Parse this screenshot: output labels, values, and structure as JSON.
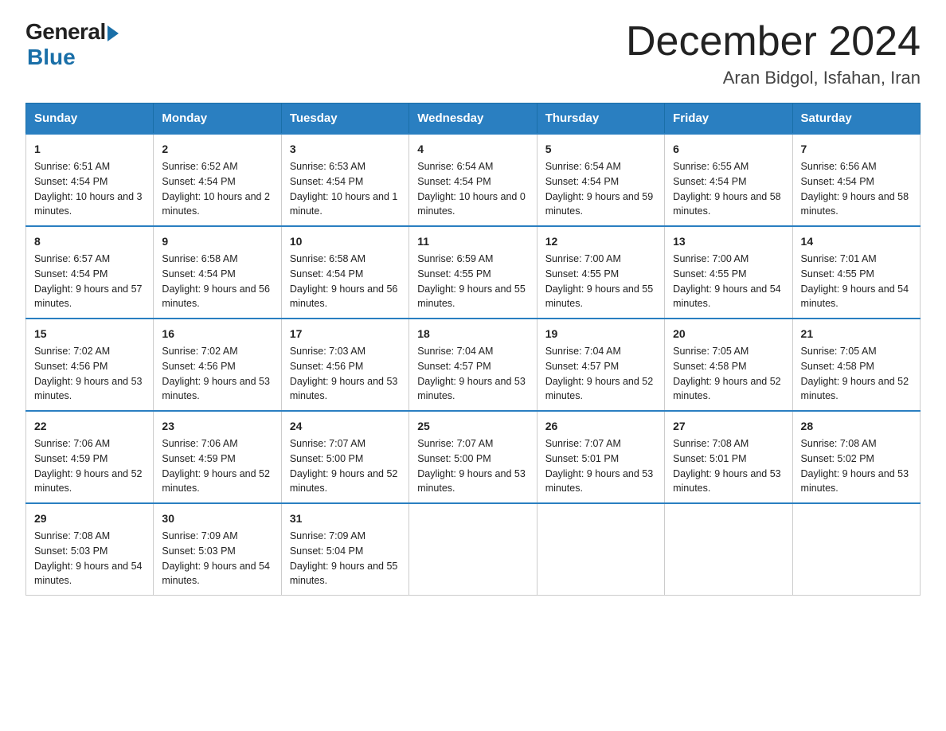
{
  "header": {
    "logo_general": "General",
    "logo_blue": "Blue",
    "month_title": "December 2024",
    "location": "Aran Bidgol, Isfahan, Iran"
  },
  "weekdays": [
    "Sunday",
    "Monday",
    "Tuesday",
    "Wednesday",
    "Thursday",
    "Friday",
    "Saturday"
  ],
  "weeks": [
    [
      {
        "day": "1",
        "sunrise": "6:51 AM",
        "sunset": "4:54 PM",
        "daylight": "10 hours and 3 minutes."
      },
      {
        "day": "2",
        "sunrise": "6:52 AM",
        "sunset": "4:54 PM",
        "daylight": "10 hours and 2 minutes."
      },
      {
        "day": "3",
        "sunrise": "6:53 AM",
        "sunset": "4:54 PM",
        "daylight": "10 hours and 1 minute."
      },
      {
        "day": "4",
        "sunrise": "6:54 AM",
        "sunset": "4:54 PM",
        "daylight": "10 hours and 0 minutes."
      },
      {
        "day": "5",
        "sunrise": "6:54 AM",
        "sunset": "4:54 PM",
        "daylight": "9 hours and 59 minutes."
      },
      {
        "day": "6",
        "sunrise": "6:55 AM",
        "sunset": "4:54 PM",
        "daylight": "9 hours and 58 minutes."
      },
      {
        "day": "7",
        "sunrise": "6:56 AM",
        "sunset": "4:54 PM",
        "daylight": "9 hours and 58 minutes."
      }
    ],
    [
      {
        "day": "8",
        "sunrise": "6:57 AM",
        "sunset": "4:54 PM",
        "daylight": "9 hours and 57 minutes."
      },
      {
        "day": "9",
        "sunrise": "6:58 AM",
        "sunset": "4:54 PM",
        "daylight": "9 hours and 56 minutes."
      },
      {
        "day": "10",
        "sunrise": "6:58 AM",
        "sunset": "4:54 PM",
        "daylight": "9 hours and 56 minutes."
      },
      {
        "day": "11",
        "sunrise": "6:59 AM",
        "sunset": "4:55 PM",
        "daylight": "9 hours and 55 minutes."
      },
      {
        "day": "12",
        "sunrise": "7:00 AM",
        "sunset": "4:55 PM",
        "daylight": "9 hours and 55 minutes."
      },
      {
        "day": "13",
        "sunrise": "7:00 AM",
        "sunset": "4:55 PM",
        "daylight": "9 hours and 54 minutes."
      },
      {
        "day": "14",
        "sunrise": "7:01 AM",
        "sunset": "4:55 PM",
        "daylight": "9 hours and 54 minutes."
      }
    ],
    [
      {
        "day": "15",
        "sunrise": "7:02 AM",
        "sunset": "4:56 PM",
        "daylight": "9 hours and 53 minutes."
      },
      {
        "day": "16",
        "sunrise": "7:02 AM",
        "sunset": "4:56 PM",
        "daylight": "9 hours and 53 minutes."
      },
      {
        "day": "17",
        "sunrise": "7:03 AM",
        "sunset": "4:56 PM",
        "daylight": "9 hours and 53 minutes."
      },
      {
        "day": "18",
        "sunrise": "7:04 AM",
        "sunset": "4:57 PM",
        "daylight": "9 hours and 53 minutes."
      },
      {
        "day": "19",
        "sunrise": "7:04 AM",
        "sunset": "4:57 PM",
        "daylight": "9 hours and 52 minutes."
      },
      {
        "day": "20",
        "sunrise": "7:05 AM",
        "sunset": "4:58 PM",
        "daylight": "9 hours and 52 minutes."
      },
      {
        "day": "21",
        "sunrise": "7:05 AM",
        "sunset": "4:58 PM",
        "daylight": "9 hours and 52 minutes."
      }
    ],
    [
      {
        "day": "22",
        "sunrise": "7:06 AM",
        "sunset": "4:59 PM",
        "daylight": "9 hours and 52 minutes."
      },
      {
        "day": "23",
        "sunrise": "7:06 AM",
        "sunset": "4:59 PM",
        "daylight": "9 hours and 52 minutes."
      },
      {
        "day": "24",
        "sunrise": "7:07 AM",
        "sunset": "5:00 PM",
        "daylight": "9 hours and 52 minutes."
      },
      {
        "day": "25",
        "sunrise": "7:07 AM",
        "sunset": "5:00 PM",
        "daylight": "9 hours and 53 minutes."
      },
      {
        "day": "26",
        "sunrise": "7:07 AM",
        "sunset": "5:01 PM",
        "daylight": "9 hours and 53 minutes."
      },
      {
        "day": "27",
        "sunrise": "7:08 AM",
        "sunset": "5:01 PM",
        "daylight": "9 hours and 53 minutes."
      },
      {
        "day": "28",
        "sunrise": "7:08 AM",
        "sunset": "5:02 PM",
        "daylight": "9 hours and 53 minutes."
      }
    ],
    [
      {
        "day": "29",
        "sunrise": "7:08 AM",
        "sunset": "5:03 PM",
        "daylight": "9 hours and 54 minutes."
      },
      {
        "day": "30",
        "sunrise": "7:09 AM",
        "sunset": "5:03 PM",
        "daylight": "9 hours and 54 minutes."
      },
      {
        "day": "31",
        "sunrise": "7:09 AM",
        "sunset": "5:04 PM",
        "daylight": "9 hours and 55 minutes."
      },
      null,
      null,
      null,
      null
    ]
  ],
  "labels": {
    "sunrise": "Sunrise:",
    "sunset": "Sunset:",
    "daylight": "Daylight:"
  }
}
